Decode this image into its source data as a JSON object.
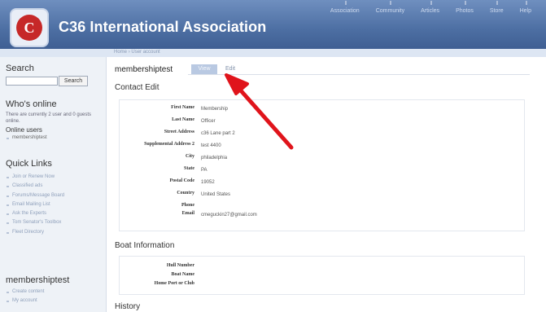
{
  "header": {
    "logo_letter": "C",
    "site_title": "C36 International Association",
    "nav": [
      "Association",
      "Community",
      "Articles",
      "Photos",
      "Store",
      "Help"
    ]
  },
  "breadcrumb": {
    "home": "Home",
    "sep": "›",
    "current": "User account"
  },
  "sidebar": {
    "search_title": "Search",
    "search_button": "Search",
    "whos_online_title": "Who's online",
    "online_text": "There are currently 2 user and 0 guests online.",
    "online_users_title": "Online users",
    "online_users": [
      "membershiptest"
    ],
    "quick_links_title": "Quick Links",
    "quick_links": [
      "Join or Renew Now",
      "Classified ads",
      "Forums/Message Board",
      "Email Mailing List",
      "Ask the Experts",
      "Tom Senator's Toolbox",
      "Fleet Directory"
    ],
    "user_block_title": "membershiptest",
    "user_links": [
      "Create content",
      "My account"
    ]
  },
  "main": {
    "page_title": "membershiptest",
    "tab_view": "View",
    "tab_edit": "Edit",
    "contact_heading": "Contact Edit",
    "contact_fields": [
      {
        "label": "First Name",
        "value": "Membership"
      },
      {
        "label": "Last Name",
        "value": "Officer"
      },
      {
        "label": "Street Address",
        "value": "c36 Lane part 2"
      },
      {
        "label": "Supplemental Address 2",
        "value": "test 4400"
      },
      {
        "label": "City",
        "value": "philadelphia"
      },
      {
        "label": "State",
        "value": "PA"
      },
      {
        "label": "Postal Code",
        "value": "19052"
      },
      {
        "label": "Country",
        "value": "United States"
      },
      {
        "label": "Phone",
        "value": ""
      },
      {
        "label": "Email",
        "value": "cmeguckin27@gmail.com"
      }
    ],
    "boat_heading": "Boat Information",
    "boat_fields": [
      {
        "label": "Hull Number",
        "value": ""
      },
      {
        "label": "Boat Name",
        "value": ""
      },
      {
        "label": "Home Port or Club",
        "value": ""
      }
    ],
    "history_heading": "History"
  },
  "colors": {
    "header_blue": "#4d6fa3",
    "arrow_red": "#e0141b",
    "sidebar_bg": "#eef2f7"
  }
}
